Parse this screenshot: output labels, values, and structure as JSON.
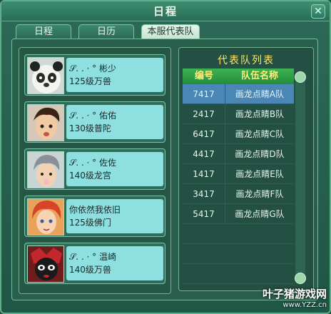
{
  "window": {
    "title": "日程",
    "close_icon": "close-icon"
  },
  "tabs": [
    {
      "label": "日程",
      "active": false
    },
    {
      "label": "日历",
      "active": false
    },
    {
      "label": "本服代表队",
      "active": true
    }
  ],
  "members": [
    {
      "name": "𝒮. . · ° 彬少",
      "level": "125级万兽",
      "avatar": "panda-avatar-icon"
    },
    {
      "name": "𝒮. . · ° 佑佑",
      "level": "130级普陀",
      "avatar": "boy-avatar-icon"
    },
    {
      "name": "𝒮. . · ° 佐佐",
      "level": "140级龙宫",
      "avatar": "gray-hair-avatar-icon"
    },
    {
      "name": "你依然我依旧",
      "level": "125级佛门",
      "avatar": "red-hair-avatar-icon"
    },
    {
      "name": "𝒮. . · ° 温崎",
      "level": "140级万兽",
      "avatar": "masked-avatar-icon"
    }
  ],
  "team_list": {
    "title": "代表队列表",
    "headers": {
      "no": "编号",
      "name": "队伍名称"
    },
    "rows": [
      {
        "no": "7417",
        "name": "画龙点睛A队",
        "selected": true
      },
      {
        "no": "2417",
        "name": "画龙点睛B队",
        "selected": false
      },
      {
        "no": "6417",
        "name": "画龙点睛C队",
        "selected": false
      },
      {
        "no": "4417",
        "name": "画龙点睛D队",
        "selected": false
      },
      {
        "no": "1417",
        "name": "画龙点睛E队",
        "selected": false
      },
      {
        "no": "3417",
        "name": "画龙点睛F队",
        "selected": false
      },
      {
        "no": "5417",
        "name": "画龙点睛G队",
        "selected": false
      }
    ]
  },
  "watermark": {
    "main": "叶子猪游戏网",
    "url": "www.YZZ.cn"
  },
  "colors": {
    "accent": "#ffe76a",
    "selected_row": "#4a86b6",
    "info_bg": "#8edfe0"
  }
}
